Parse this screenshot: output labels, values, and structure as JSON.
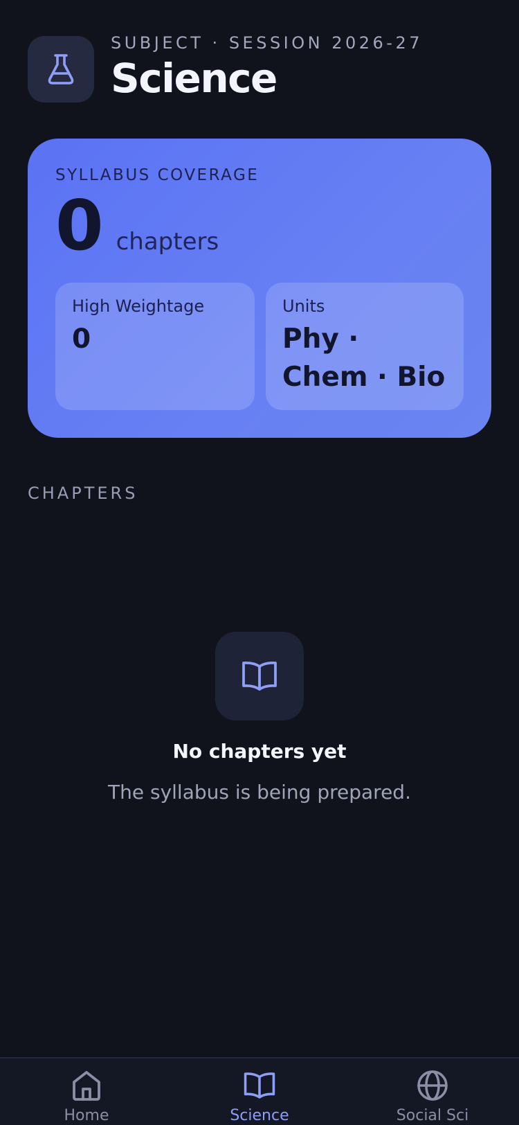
{
  "header": {
    "eyebrow": "SUBJECT · SESSION 2026-27",
    "title": "Science",
    "icon": "flask-icon"
  },
  "coverage": {
    "label": "SYLLABUS COVERAGE",
    "count": "0",
    "unit": "chapters",
    "tiles": [
      {
        "label": "High Weightage",
        "value": "0"
      },
      {
        "label": "Units",
        "value": "Phy · Chem · Bio"
      }
    ]
  },
  "chapters": {
    "section_label": "CHAPTERS",
    "empty_icon": "open-book-icon",
    "empty_title": "No chapters yet",
    "empty_subtitle": "The syllabus is being prepared."
  },
  "nav": {
    "items": [
      {
        "label": "Home",
        "icon": "home-icon",
        "active": false
      },
      {
        "label": "Science",
        "icon": "book-icon",
        "active": true
      },
      {
        "label": "Social Sci",
        "icon": "globe-icon",
        "active": false
      }
    ]
  },
  "colors": {
    "background": "#11131c",
    "card": "#5b73f4",
    "accent": "#8d9ef8"
  }
}
